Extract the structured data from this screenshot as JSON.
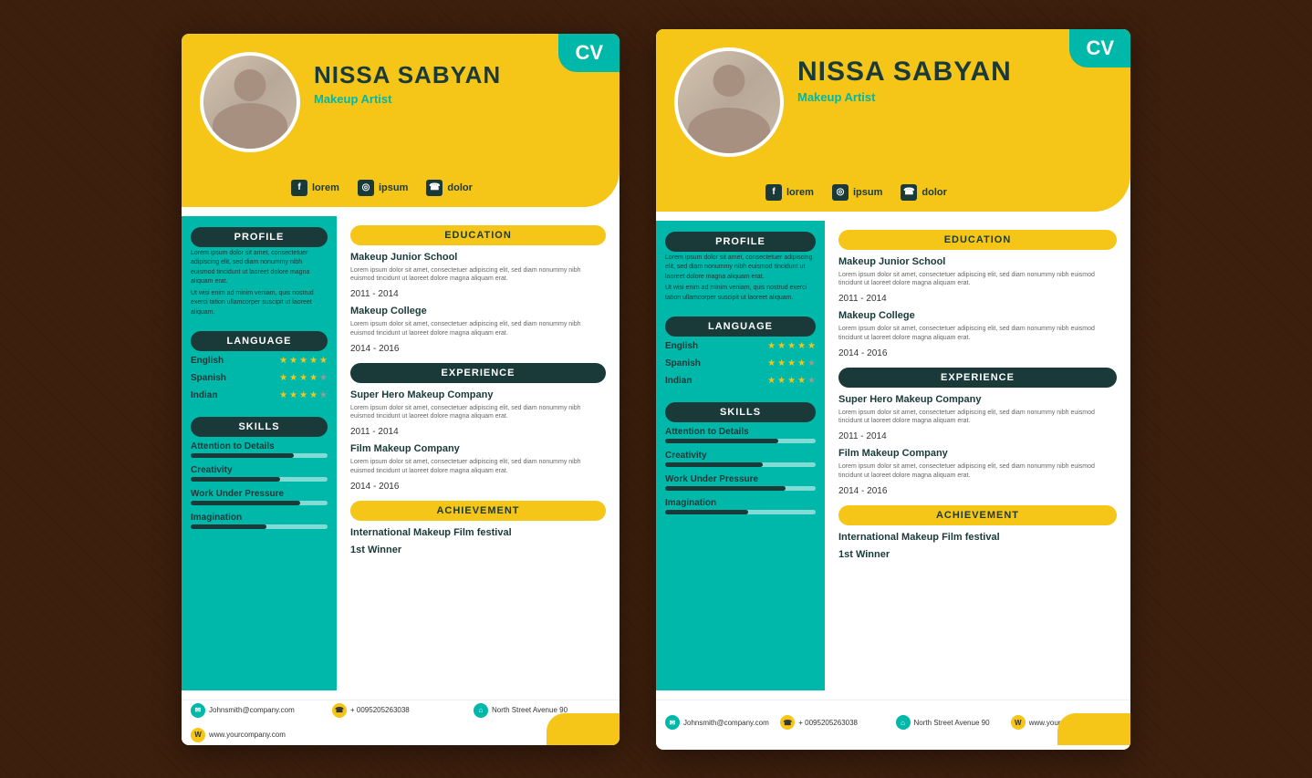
{
  "cv": {
    "label": "CV",
    "name": "NISSA SABYAN",
    "title": "Makeup Artist",
    "social": {
      "facebook": "lorem",
      "instagram": "ipsum",
      "whatsapp": "dolor"
    },
    "profile": {
      "heading": "PROFILE",
      "text1": "Lorem ipsum dolor sit amet, consectetuer adipiscing elit, sed diam nonummy nibh euismod tincidunt ut laoreet dolore magna aliquam erat.",
      "text2": "Ut wisi enim ad minim veniam, quis nostrud exerci tation ullamcorper suscipit ut laoreet aliquam."
    },
    "language": {
      "heading": "LANGUAGE",
      "items": [
        {
          "name": "English",
          "stars": 5
        },
        {
          "name": "Spanish",
          "stars": 4
        },
        {
          "name": "Indian",
          "stars": 4
        }
      ]
    },
    "skills": {
      "heading": "SKILLS",
      "items": [
        {
          "name": "Attention to Details",
          "pct": 75
        },
        {
          "name": "Creativity",
          "pct": 65
        },
        {
          "name": "Work Under Pressure",
          "pct": 80
        },
        {
          "name": "Imagination",
          "pct": 55
        }
      ]
    },
    "education": {
      "heading": "EDUCATION",
      "entries": [
        {
          "title": "Makeup Junior School",
          "text": "Lorem ipsum dolor sit amet, consectetuer adipiscing elit, sed diam nonummy nibh euismod tincidunt ut laoreet dolore magna aliquam erat.",
          "year": "2011 - 2014"
        },
        {
          "title": "Makeup College",
          "text": "Lorem ipsum dolor sit amet, consectetuer adipiscing elit, sed diam nonummy nibh euismod tincidunt ut laoreet dolore magna aliquam erat.",
          "year": "2014 - 2016"
        }
      ]
    },
    "experience": {
      "heading": "EXPERIENCE",
      "entries": [
        {
          "title": "Super Hero Makeup Company",
          "text": "Lorem ipsum dolor sit amet, consectetuer adipiscing elit, sed diam nonummy nibh euismod tincidunt ut laoreet dolore magna aliquam erat.",
          "year": "2011 - 2014"
        },
        {
          "title": "Film Makeup Company",
          "text": "Lorem ipsum dolor sit amet, consectetuer adipiscing elit, sed diam nonummy nibh euismod tincidunt ut laoreet dolore magna aliquam erat.",
          "year": "2014 - 2016"
        }
      ]
    },
    "achievement": {
      "heading": "ACHIEVEMENT",
      "title": "International Makeup Film festival",
      "subtitle": "1st Winner"
    },
    "footer": {
      "email": "Johnsmith@company.com",
      "phone": "+ 0095205263038",
      "address": "North Street Avenue 90",
      "website": "www.yourcompany.com"
    }
  }
}
